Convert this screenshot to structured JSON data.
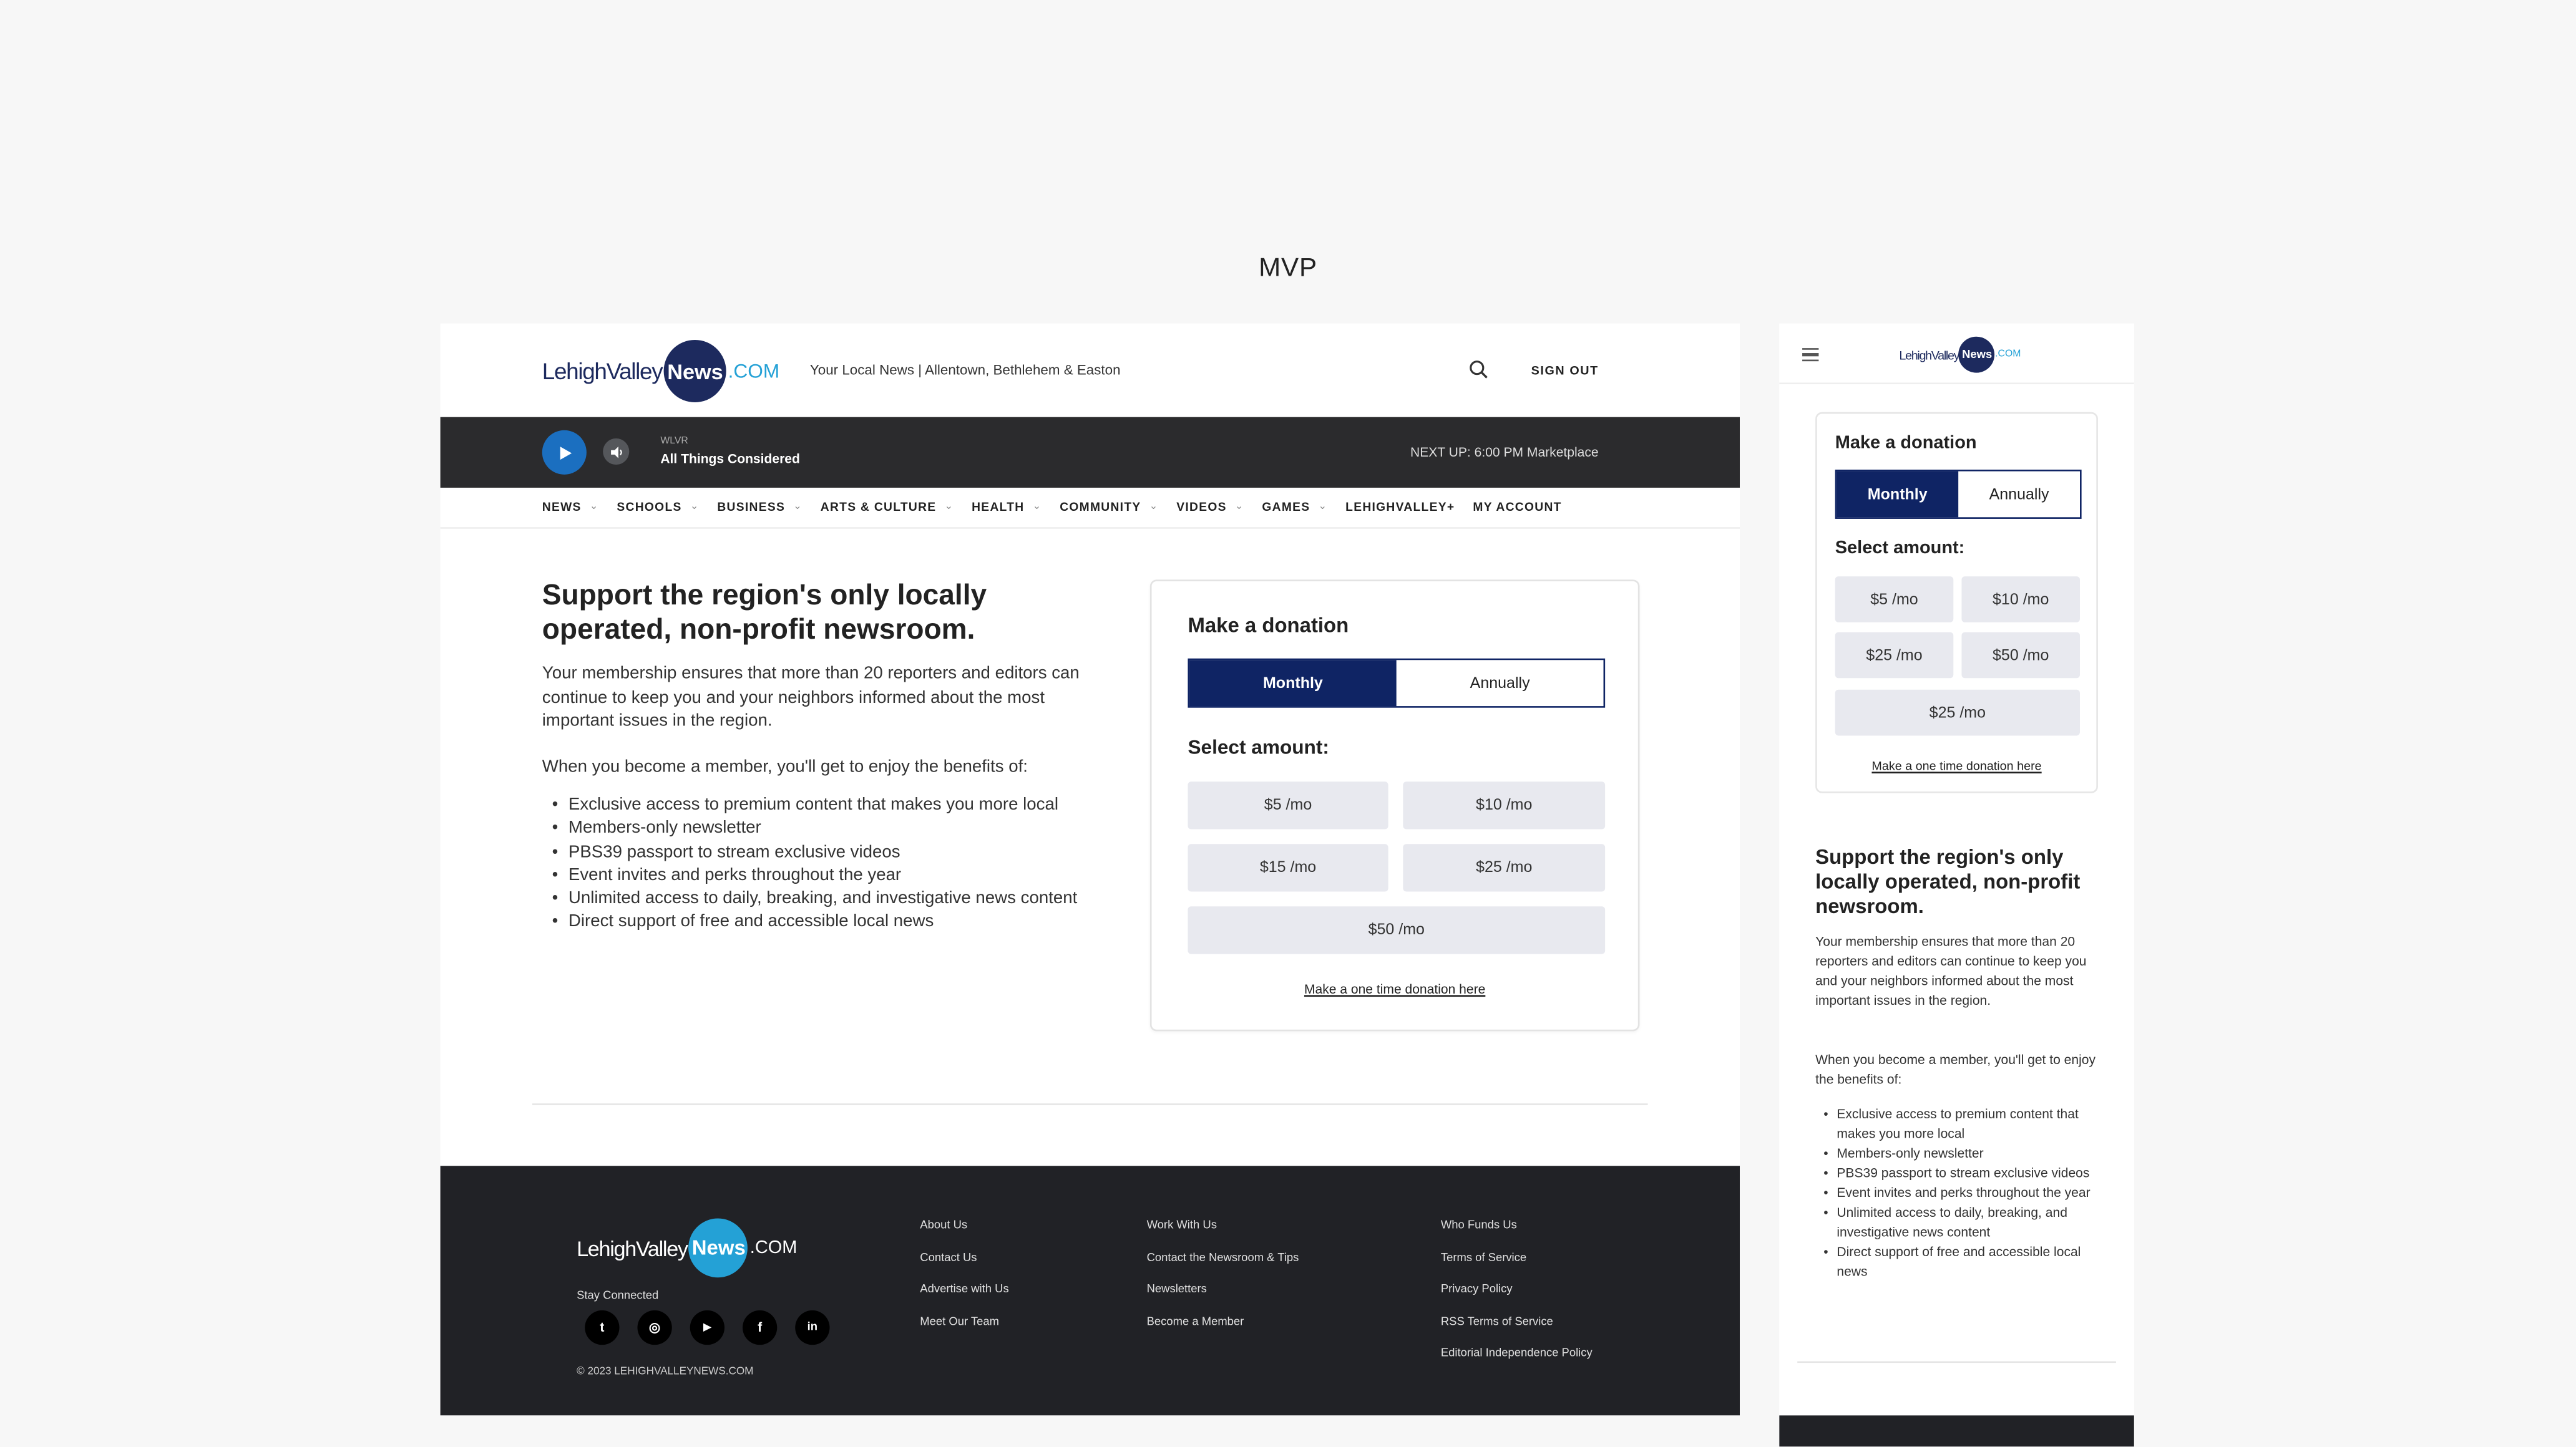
{
  "page_heading": "MVP",
  "header": {
    "logo": {
      "lv": "LehighValley",
      "news": "News",
      "com": ".COM"
    },
    "tagline": "Your Local News | Allentown, Bethlehem & Easton",
    "sign_out": "SIGN OUT"
  },
  "player": {
    "station": "WLVR",
    "show": "All Things Considered",
    "next_up": "NEXT UP: 6:00 PM Marketplace"
  },
  "nav": [
    "NEWS",
    "SCHOOLS",
    "BUSINESS",
    "ARTS & CULTURE",
    "HEALTH",
    "COMMUNITY",
    "VIDEOS",
    "GAMES",
    "LEHIGHVALLEY+",
    "MY ACCOUNT"
  ],
  "content": {
    "headline": "Support the region's only locally operated, non-profit newsroom.",
    "intro": "Your membership ensures that more than 20 reporters and editors can continue to keep you and your neighbors informed about the most important issues in the region.",
    "benefits_intro": "When you become a member, you'll get to enjoy the benefits of:",
    "benefits": [
      "Exclusive access to premium content that makes you more local",
      "Members-only newsletter",
      "PBS39 passport to stream exclusive videos",
      "Event invites and perks throughout the year",
      "Unlimited access to daily, breaking, and investigative news content",
      "Direct support of free and accessible local news"
    ]
  },
  "donation": {
    "title": "Make a donation",
    "monthly": "Monthly",
    "annually": "Annually",
    "select_amount": "Select amount:",
    "amounts": [
      "$5 /mo",
      "$10 /mo",
      "$15 /mo",
      "$25 /mo",
      "$50 /mo"
    ],
    "one_time": "Make a one time donation here"
  },
  "mobile_donation": {
    "amounts": [
      "$5 /mo",
      "$10 /mo",
      "$25 /mo",
      "$50 /mo",
      "$25 /mo"
    ]
  },
  "footer": {
    "stay_connected": "Stay Connected",
    "social": [
      {
        "icon": "twitter-icon",
        "glyph": "t"
      },
      {
        "icon": "instagram-icon",
        "glyph": "◎"
      },
      {
        "icon": "youtube-icon",
        "glyph": "▶"
      },
      {
        "icon": "facebook-icon",
        "glyph": "f"
      },
      {
        "icon": "linkedin-icon",
        "glyph": "in"
      }
    ],
    "copyright": "© 2023 LEHIGHVALLEYNEWS.COM",
    "col1": [
      "About Us",
      "Contact Us",
      "Advertise with Us",
      "Meet Our Team"
    ],
    "col2": [
      "Work With Us",
      "Contact the Newsroom & Tips",
      "Newsletters",
      "Become a Member"
    ],
    "col3": [
      "Who Funds Us",
      "Terms of Service",
      "Privacy Policy",
      "RSS Terms of Service",
      "Editorial Independence Policy"
    ]
  },
  "colors": {
    "navy": "#0f2464",
    "brand_blue": "#24a1d6",
    "player_blue": "#1b6fc0",
    "footer_bg": "#212226"
  }
}
